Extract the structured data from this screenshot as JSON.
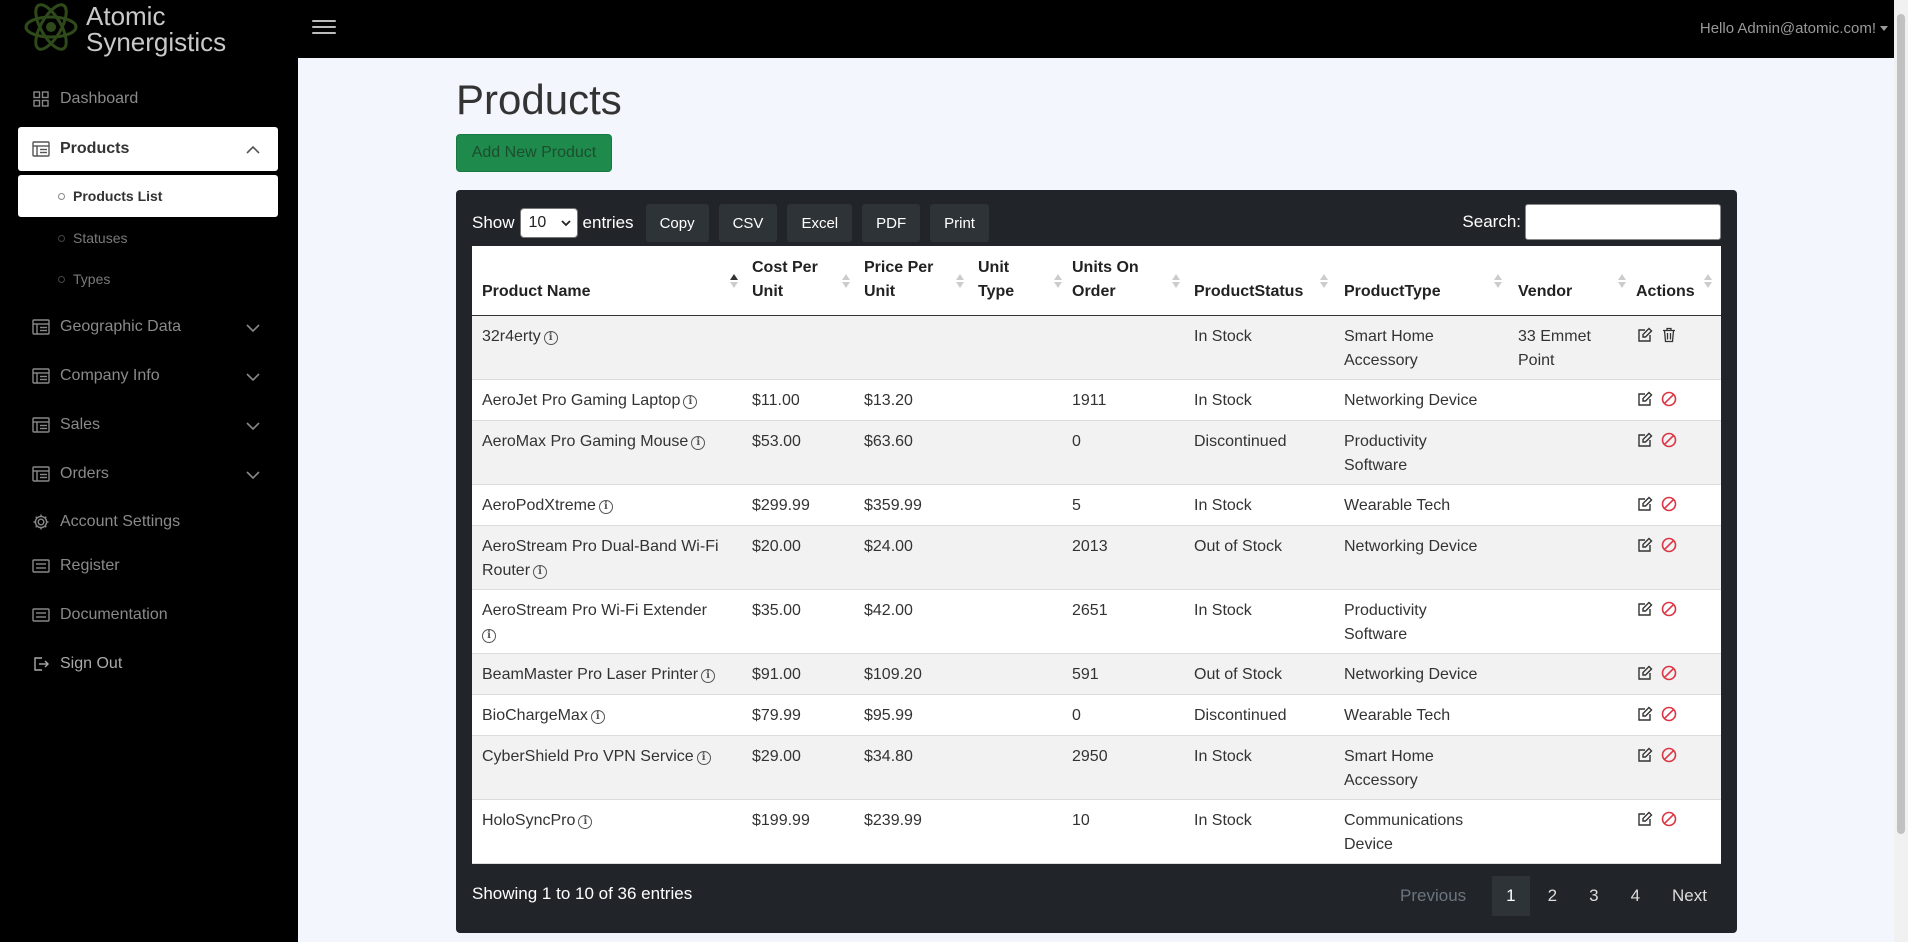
{
  "brand": {
    "line1": "Atomic",
    "line2": "Synergistics"
  },
  "user_menu": "Hello Admin@atomic.com!",
  "sidebar": {
    "items": [
      {
        "label": "Dashboard",
        "icon": "grid-icon"
      },
      {
        "label": "Products",
        "icon": "table-icon",
        "expanded": true
      },
      {
        "label": "Geographic Data",
        "icon": "table-icon"
      },
      {
        "label": "Company Info",
        "icon": "table-icon"
      },
      {
        "label": "Sales",
        "icon": "table-icon"
      },
      {
        "label": "Orders",
        "icon": "table-icon"
      },
      {
        "label": "Account Settings",
        "icon": "gear-icon"
      },
      {
        "label": "Register",
        "icon": "list-icon"
      },
      {
        "label": "Documentation",
        "icon": "list-icon"
      },
      {
        "label": "Sign Out",
        "icon": "sign-out-icon"
      }
    ],
    "sub_items": [
      {
        "label": "Products List"
      },
      {
        "label": "Statuses"
      },
      {
        "label": "Types"
      }
    ]
  },
  "main": {
    "title": "Products",
    "add_button": "Add New Product",
    "show_label": "Show",
    "page_length": "10",
    "entries_label": "entries",
    "export_buttons": [
      "Copy",
      "CSV",
      "Excel",
      "PDF",
      "Print"
    ],
    "search_label": "Search:",
    "search_value": "",
    "columns": [
      {
        "line1": "Product Name",
        "line2": ""
      },
      {
        "line1": "Cost Per",
        "line2": "Unit"
      },
      {
        "line1": "Price Per",
        "line2": "Unit"
      },
      {
        "line1": "Unit",
        "line2": "Type"
      },
      {
        "line1": "Units On",
        "line2": "Order"
      },
      {
        "line1": "ProductStatus",
        "line2": ""
      },
      {
        "line1": "ProductType",
        "line2": ""
      },
      {
        "line1": "Vendor",
        "line2": ""
      },
      {
        "line1": "Actions",
        "line2": ""
      }
    ],
    "rows": [
      {
        "name": [
          "32r4erty"
        ],
        "cost": "",
        "price": "",
        "unit_type": "",
        "units_on_order": "",
        "status": "In Stock",
        "type": [
          "Smart Home",
          "Accessory"
        ],
        "vendor": [
          "33 Emmet",
          "Point"
        ],
        "action": "delete"
      },
      {
        "name": [
          "AeroJet Pro Gaming Laptop"
        ],
        "cost": "$11.00",
        "price": "$13.20",
        "unit_type": "",
        "units_on_order": "1911",
        "status": "In Stock",
        "type": [
          "Networking Device"
        ],
        "vendor": [],
        "action": "disabled"
      },
      {
        "name": [
          "AeroMax Pro Gaming Mouse"
        ],
        "cost": "$53.00",
        "price": "$63.60",
        "unit_type": "",
        "units_on_order": "0",
        "status": "Discontinued",
        "type": [
          "Productivity",
          "Software"
        ],
        "vendor": [],
        "action": "disabled"
      },
      {
        "name": [
          "AeroPodXtreme"
        ],
        "cost": "$299.99",
        "price": "$359.99",
        "unit_type": "",
        "units_on_order": "5",
        "status": "In Stock",
        "type": [
          "Wearable Tech"
        ],
        "vendor": [],
        "action": "disabled"
      },
      {
        "name": [
          "AeroStream Pro Dual-Band Wi-Fi",
          "Router"
        ],
        "cost": "$20.00",
        "price": "$24.00",
        "unit_type": "",
        "units_on_order": "2013",
        "status": "Out of Stock",
        "type": [
          "Networking Device"
        ],
        "vendor": [],
        "action": "disabled"
      },
      {
        "name": [
          "AeroStream Pro Wi-Fi Extender",
          ""
        ],
        "cost": "$35.00",
        "price": "$42.00",
        "unit_type": "",
        "units_on_order": "2651",
        "status": "In Stock",
        "type": [
          "Productivity",
          "Software"
        ],
        "vendor": [],
        "action": "disabled"
      },
      {
        "name": [
          "BeamMaster Pro Laser Printer"
        ],
        "cost": "$91.00",
        "price": "$109.20",
        "unit_type": "",
        "units_on_order": "591",
        "status": "Out of Stock",
        "type": [
          "Networking Device"
        ],
        "vendor": [],
        "action": "disabled"
      },
      {
        "name": [
          "BioChargeMax"
        ],
        "cost": "$79.99",
        "price": "$95.99",
        "unit_type": "",
        "units_on_order": "0",
        "status": "Discontinued",
        "type": [
          "Wearable Tech"
        ],
        "vendor": [],
        "action": "disabled"
      },
      {
        "name": [
          "CyberShield Pro VPN Service"
        ],
        "cost": "$29.00",
        "price": "$34.80",
        "unit_type": "",
        "units_on_order": "2950",
        "status": "In Stock",
        "type": [
          "Smart Home",
          "Accessory"
        ],
        "vendor": [],
        "action": "disabled"
      },
      {
        "name": [
          "HoloSyncPro"
        ],
        "cost": "$199.99",
        "price": "$239.99",
        "unit_type": "",
        "units_on_order": "10",
        "status": "In Stock",
        "type": [
          "Communications",
          "Device"
        ],
        "vendor": [],
        "action": "disabled"
      }
    ],
    "footer_info": "Showing 1 to 10 of 36 entries",
    "pagination": [
      "Previous",
      "1",
      "2",
      "3",
      "4",
      "Next"
    ]
  },
  "colors": {
    "sidebar_bg": "#000000",
    "main_bg": "#f3f6fc",
    "panel_bg": "#212529",
    "accent_green": "#1e8a4c",
    "disabled_red": "#dc3545"
  }
}
